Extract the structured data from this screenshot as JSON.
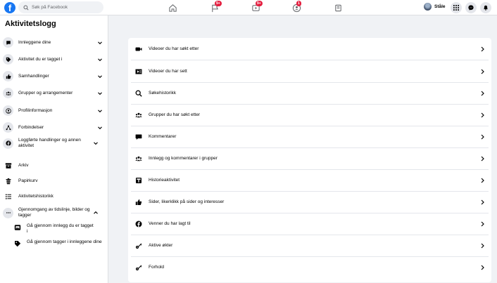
{
  "topbar": {
    "logo_letter": "f",
    "search_placeholder": "Søk på Facebook",
    "badges": {
      "pages": "9+",
      "watch": "9+",
      "groups": "1"
    },
    "user_name": "Ståle"
  },
  "sidebar": {
    "title": "Aktivitetslogg",
    "items": [
      {
        "label": "Innleggene dine",
        "icon": "post-icon"
      },
      {
        "label": "Aktivitet du er tagget i",
        "icon": "tag-icon"
      },
      {
        "label": "Samhandlinger",
        "icon": "thumbs-up-icon"
      },
      {
        "label": "Grupper og arrangementer",
        "icon": "groups-icon"
      },
      {
        "label": "Profilinformasjon",
        "icon": "profile-icon"
      },
      {
        "label": "Forbindelser",
        "icon": "connections-icon"
      },
      {
        "label": "Loggførte handlinger og annen aktivitet",
        "icon": "facebook-icon"
      },
      {
        "label": "Arkiv",
        "icon": "archive-icon"
      },
      {
        "label": "Papirkurv",
        "icon": "trash-icon"
      },
      {
        "label": "Aktivitetshistorikk",
        "icon": "list-icon"
      },
      {
        "label": "Gjennomgang av tidslinje, bilder og tagger",
        "icon": "more-icon"
      },
      {
        "label": "Gå gjennom innlegg du er tagget i",
        "icon": "review-post-icon"
      },
      {
        "label": "Gå gjennom tagger i innleggene dine",
        "icon": "review-tag-icon"
      }
    ]
  },
  "main": {
    "rows": [
      {
        "label": "Videoer du har søkt etter",
        "icon": "video-search-icon"
      },
      {
        "label": "Videoer du har sett",
        "icon": "video-watched-icon"
      },
      {
        "label": "Søkehistorikk",
        "icon": "search-icon"
      },
      {
        "label": "Grupper du har søkt etter",
        "icon": "groups-icon"
      },
      {
        "label": "Kommentarer",
        "icon": "comment-icon"
      },
      {
        "label": "Innlegg og kommentarer i grupper",
        "icon": "groups-icon"
      },
      {
        "label": "Historieaktivitet",
        "icon": "story-icon"
      },
      {
        "label": "Sider, likerklikk på sider og interesser",
        "icon": "thumbs-up-icon"
      },
      {
        "label": "Venner du har lagt til",
        "icon": "facebook-icon"
      },
      {
        "label": "Aktive økter",
        "icon": "key-icon"
      },
      {
        "label": "Forhold",
        "icon": "key-icon"
      }
    ]
  },
  "colors": {
    "brand": "#1877f2",
    "badge": "#e41e3f",
    "page_bg": "#f0f2f5"
  }
}
